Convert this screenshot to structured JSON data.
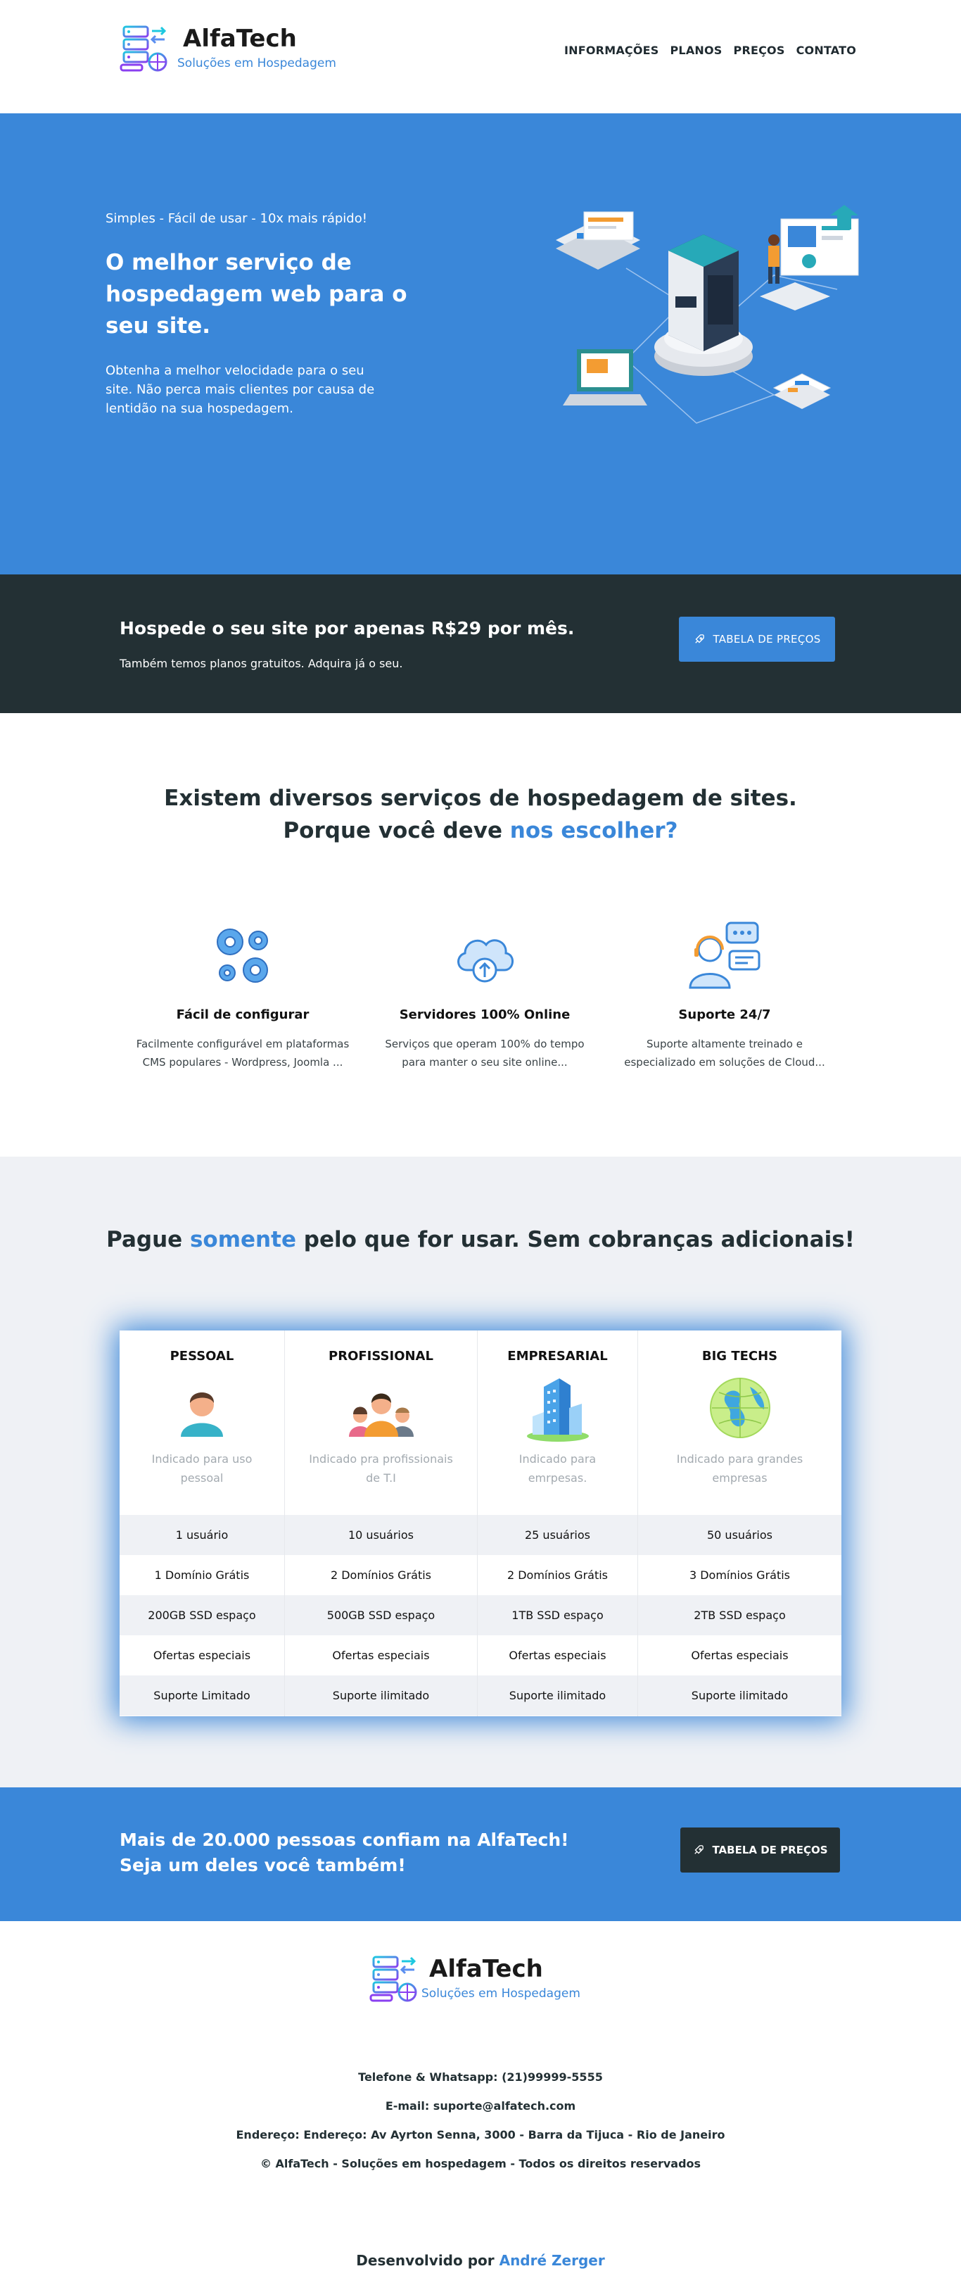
{
  "brand": {
    "name": "AlfaTech",
    "tagline": "Soluções em Hospedagem",
    "accent_color": "#3a87d9",
    "dark_color": "#233034"
  },
  "nav": {
    "items": [
      "INFORMAÇÕES",
      "PLANOS",
      "PREÇOS",
      "CONTATO"
    ]
  },
  "hero": {
    "eyebrow": "Simples - Fácil de usar - 10x mais rápido!",
    "title": "O melhor serviço de hospedagem web para o seu site.",
    "text": "Obtenha a melhor velocidade para o seu site. Não perca mais clientes por causa de lentidão na sua hospedagem."
  },
  "banner": {
    "title": "Hospede o seu site por apenas R$29 por mês.",
    "subtitle": "Também temos planos gratuitos. Adquira já o seu.",
    "button_label": "TABELA DE PREÇOS",
    "button_icon": "rocket-icon"
  },
  "why": {
    "line1": "Existem diversos serviços de hospedagem de sites.",
    "line2_prefix": "Porque você deve ",
    "line2_highlight": "nos escolher?",
    "features": [
      {
        "icon": "gears-icon",
        "title": "Fácil de configurar",
        "text_1": "Facilmente configurável em plataformas",
        "text_2": "CMS populares - Wordpress, Joomla ..."
      },
      {
        "icon": "cloud-upload-icon",
        "title": "Servidores 100% Online",
        "text_1": "Serviços que operam 100% do tempo",
        "text_2": "para manter o seu site online..."
      },
      {
        "icon": "support-agent-icon",
        "title": "Suporte 24/7",
        "text_1": "Suporte altamente treinado e",
        "text_2": "especializado em soluções de Cloud..."
      }
    ]
  },
  "pricing": {
    "title_prefix": "Pague ",
    "title_highlight": "somente",
    "title_suffix": " pelo que for usar. Sem cobranças adicionais!",
    "plans": [
      {
        "name": "PESSOAL",
        "icon": "person-icon",
        "desc": "Indicado para uso pessoal",
        "features": [
          "1 usuário",
          "1 Domínio Grátis",
          "200GB SSD espaço",
          "Ofertas especiais",
          "Suporte Limitado"
        ]
      },
      {
        "name": "PROFISSIONAL",
        "icon": "team-icon",
        "desc": "Indicado pra profissionais de T.I",
        "features": [
          "10 usuários",
          "2 Domínios Grátis",
          "500GB SSD espaço",
          "Ofertas especiais",
          "Suporte ilimitado"
        ]
      },
      {
        "name": "EMPRESARIAL",
        "icon": "building-icon",
        "desc": "Indicado para emrpesas.",
        "features": [
          "25 usuários",
          "2 Domínios Grátis",
          "1TB SSD espaço",
          "Ofertas especiais",
          "Suporte ilimitado"
        ]
      },
      {
        "name": "BIG TECHS",
        "icon": "globe-icon",
        "desc": "Indicado para grandes empresas",
        "features": [
          "50 usuários",
          "3 Domínios Grátis",
          "2TB SSD espaço",
          "Ofertas especiais",
          "Suporte ilimitado"
        ]
      }
    ]
  },
  "cta": {
    "line1": "Mais de 20.000 pessoas confiam na AlfaTech!",
    "line2": "Seja um deles você também!",
    "button_label": "TABELA DE PREÇOS",
    "button_icon": "rocket-icon"
  },
  "footer": {
    "phone": "Telefone & Whatsapp: (21)99999-5555",
    "email": "E-mail: suporte@alfatech.com",
    "address": "Endereço: Endereço: Av Ayrton Senna, 3000 - Barra da Tijuca - Rio de Janeiro",
    "copyright": "© AlfaTech - Soluções em hospedagem - Todos os direitos reservados",
    "credit_prefix": "Desenvolvido por ",
    "credit_name": "André Zerger"
  }
}
